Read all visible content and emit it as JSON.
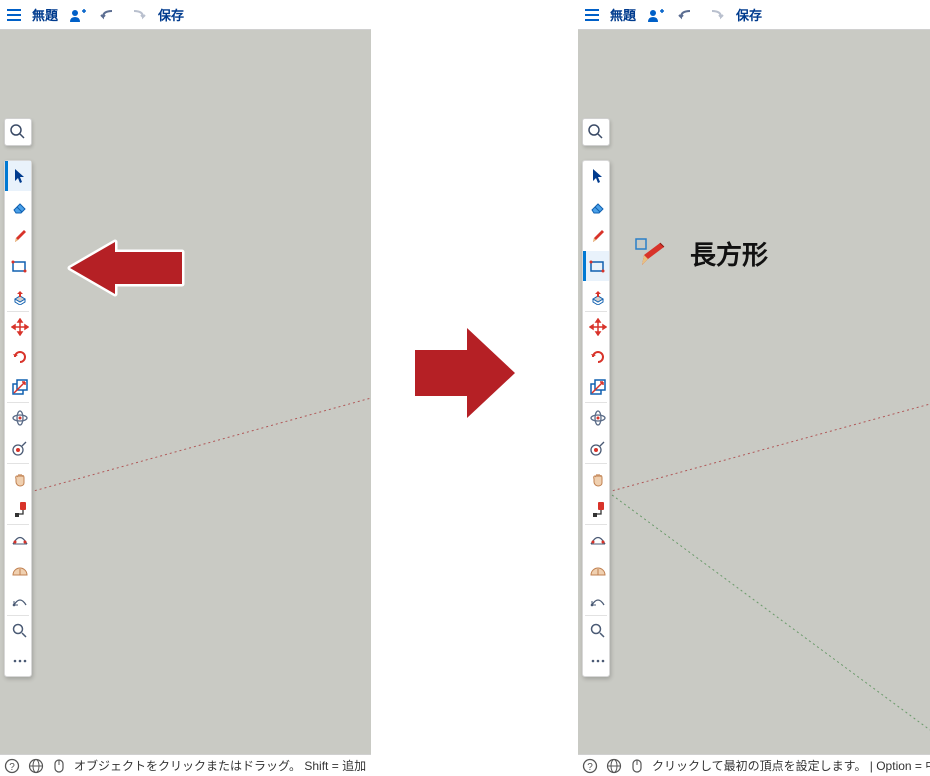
{
  "header": {
    "title": "無題",
    "save_label": "保存"
  },
  "status": {
    "left": "オブジェクトをクリックまたはドラッグ。 Shift = 追加",
    "right": "クリックして最初の頂点を設定します。 | Option = 中"
  },
  "tooltip": {
    "rectangle": "長方形"
  },
  "tools": [
    {
      "name": "select",
      "icon": "select-icon"
    },
    {
      "name": "eraser",
      "icon": "eraser-icon"
    },
    {
      "name": "pencil",
      "icon": "pencil-icon"
    },
    {
      "name": "rectangle",
      "icon": "rectangle-icon"
    },
    {
      "name": "pushpull",
      "icon": "pushpull-icon"
    },
    {
      "name": "move",
      "icon": "move-icon"
    },
    {
      "name": "rotate",
      "icon": "rotate-icon"
    },
    {
      "name": "scale",
      "icon": "scale-icon"
    },
    {
      "name": "orbit",
      "icon": "orbit-icon"
    },
    {
      "name": "tapemeasure",
      "icon": "tape-icon"
    },
    {
      "name": "pan",
      "icon": "pan-icon"
    },
    {
      "name": "paint",
      "icon": "paint-icon"
    },
    {
      "name": "offset",
      "icon": "offset-icon"
    },
    {
      "name": "protractor",
      "icon": "protractor-icon"
    },
    {
      "name": "arc",
      "icon": "arc-icon"
    },
    {
      "name": "zoom",
      "icon": "zoom-icon"
    },
    {
      "name": "more",
      "icon": "more-icon"
    }
  ]
}
